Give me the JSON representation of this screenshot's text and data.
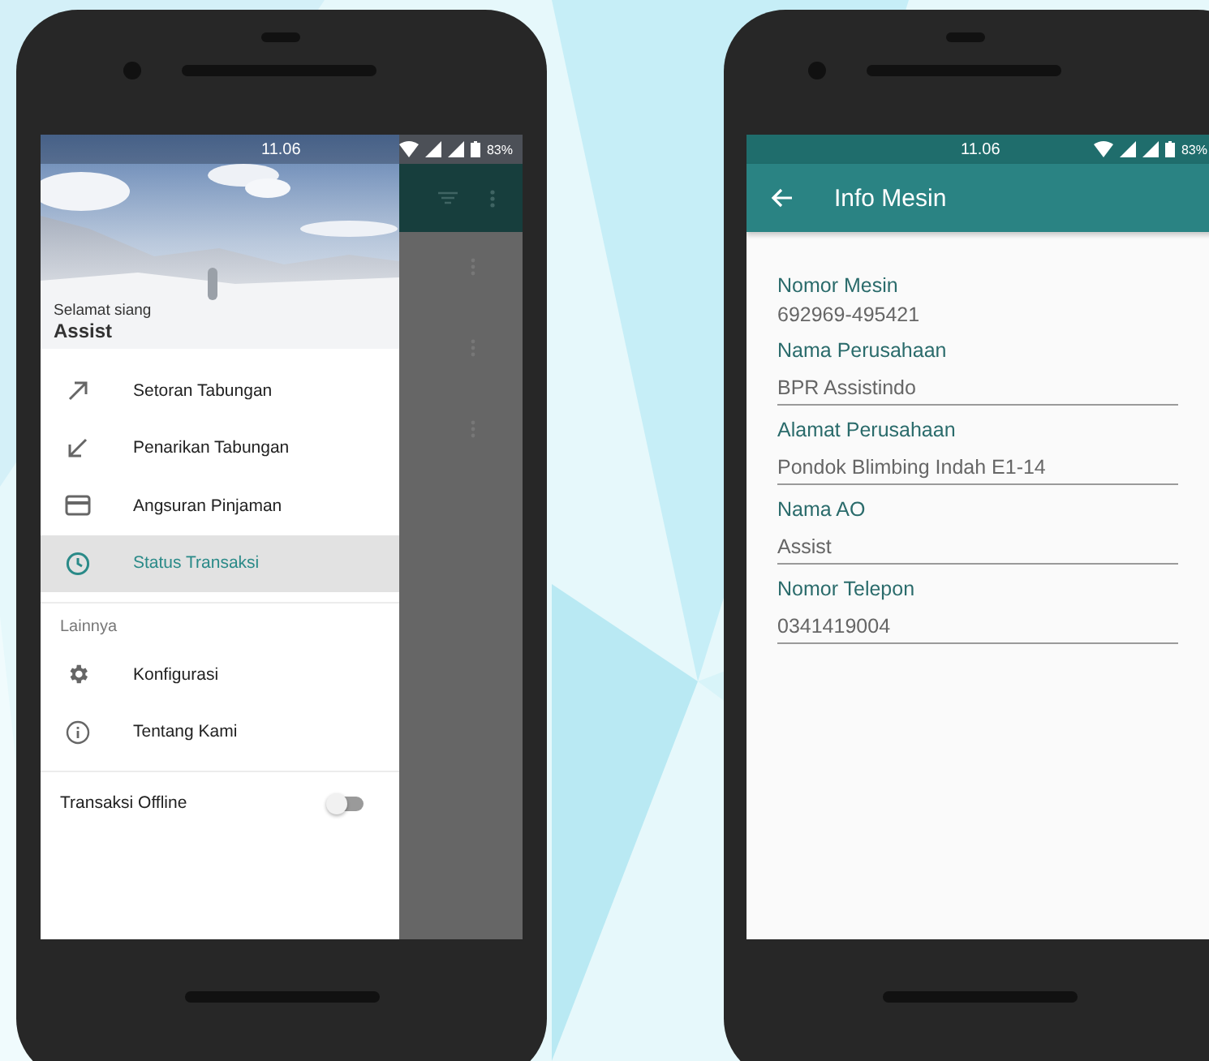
{
  "left_phone": {
    "status_bar": {
      "time": "11.06",
      "battery": "83%"
    },
    "drawer": {
      "greeting": "Selamat siang",
      "user": "Assist",
      "items": [
        {
          "label": "Setoran Tabungan",
          "selected": false
        },
        {
          "label": "Penarikan Tabungan",
          "selected": false
        },
        {
          "label": "Angsuran Pinjaman",
          "selected": false
        },
        {
          "label": "Status Transaksi",
          "selected": true
        }
      ],
      "section_label": "Lainnya",
      "more_items": [
        {
          "label": "Konfigurasi"
        },
        {
          "label": "Tentang Kami"
        }
      ],
      "offline": {
        "label": "Transaksi Offline",
        "on": false
      }
    }
  },
  "right_phone": {
    "status_bar": {
      "time": "11.06",
      "battery": "83%"
    },
    "toolbar": {
      "title": "Info Mesin"
    },
    "fields": [
      {
        "label": "Nomor Mesin",
        "value": "692969-495421",
        "kind": "text"
      },
      {
        "label": "Nama Perusahaan",
        "value": "BPR Assistindo",
        "kind": "input"
      },
      {
        "label": "Alamat Perusahaan",
        "value": "Pondok Blimbing Indah E1-14",
        "kind": "input"
      },
      {
        "label": "Nama AO",
        "value": "Assist",
        "kind": "input"
      },
      {
        "label": "Nomor Telepon",
        "value": "0341419004",
        "kind": "input"
      }
    ]
  }
}
